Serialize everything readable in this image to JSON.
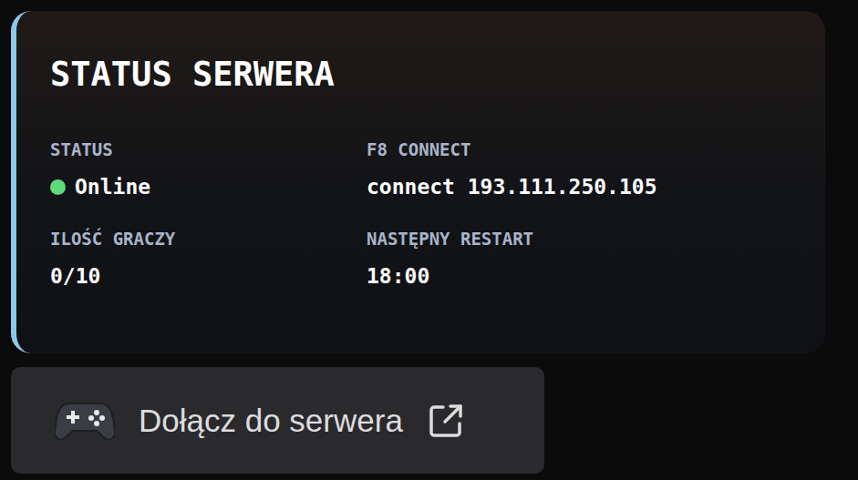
{
  "card": {
    "title": "STATUS SERWERA",
    "fields": [
      {
        "label": "STATUS",
        "value": "Online",
        "kind": "status",
        "color": "#5fd97a"
      },
      {
        "label": "F8 CONNECT",
        "value": "connect 193.111.250.105",
        "kind": "text"
      },
      {
        "label": "ILOŚĆ GRACZY",
        "value": "0/10",
        "kind": "text"
      },
      {
        "label": "NASTĘPNY RESTART",
        "value": "18:00",
        "kind": "text"
      }
    ]
  },
  "button": {
    "label": "Dołącz do serwera"
  }
}
